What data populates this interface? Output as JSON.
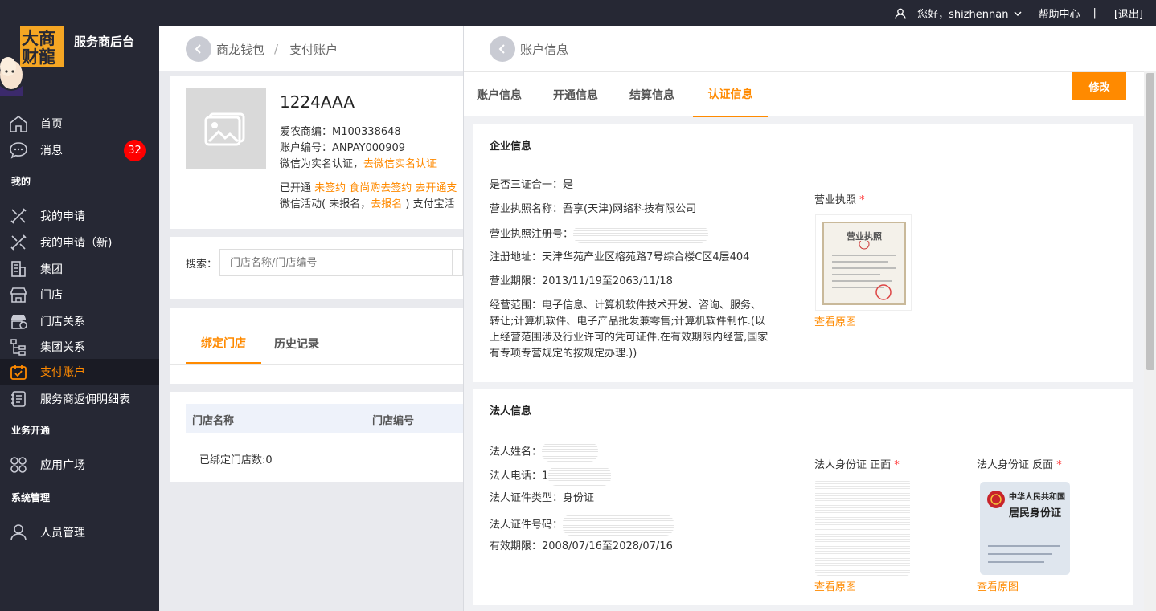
{
  "topbar": {
    "greeting": "您好，shizhennan",
    "help": "帮助中心",
    "separator": "|",
    "logout": "[退出]"
  },
  "sidebar": {
    "logo_text": "大商财龍",
    "brand": "服务商后台",
    "items": [
      {
        "label": "首页",
        "icon": "home-icon"
      },
      {
        "label": "消息",
        "icon": "message-icon",
        "badge": "32"
      },
      {
        "section": "我的"
      },
      {
        "label": "我的申请",
        "icon": "apply-icon"
      },
      {
        "label": "我的申请（新)",
        "icon": "apply-new-icon"
      },
      {
        "label": "集团",
        "icon": "building-icon"
      },
      {
        "label": "门店",
        "icon": "store-icon"
      },
      {
        "label": "门店关系",
        "icon": "store-relation-icon"
      },
      {
        "label": "集团关系",
        "icon": "group-relation-icon"
      },
      {
        "label": "支付账户",
        "icon": "payment-account-icon",
        "active": true
      },
      {
        "label": "服务商返佣明细表",
        "icon": "commission-icon"
      },
      {
        "section": "业务开通"
      },
      {
        "label": "应用广场",
        "icon": "apps-icon"
      },
      {
        "section": "系统管理"
      },
      {
        "label": "人员管理",
        "icon": "user-icon"
      }
    ]
  },
  "main": {
    "breadcrumb": {
      "first": "商龙钱包",
      "sep": "/",
      "second": "支付账户"
    },
    "account": {
      "name": "1224AAA",
      "merchant_id": "爱农商编：M100338648",
      "account_no": "账户编号：ANPAY000909",
      "wechat_verify_prefix": "微信为实名认证，",
      "wechat_verify_link": "去微信实名认证",
      "opened_prefix": "已开通",
      "opened_status": "未签约 食尚购去签约 去开通支",
      "wechat_activity_prefix": "微信活动( 未报名，",
      "wechat_activity_link": "去报名",
      "wechat_activity_suffix": ") 支付宝活"
    },
    "search": {
      "label": "搜索：",
      "placeholder": "门店名称/门店编号"
    },
    "tabs": [
      "绑定门店",
      "历史记录"
    ],
    "table": {
      "headers": [
        "门店名称",
        "门店编号"
      ],
      "summary": "已绑定门店数:0"
    }
  },
  "panel": {
    "title": "账户信息",
    "tabs": [
      "账户信息",
      "开通信息",
      "结算信息",
      "认证信息"
    ],
    "active_tab": "认证信息",
    "edit_button": "修改",
    "enterprise": {
      "title": "企业信息",
      "three_in_one": "是否三证合一：是",
      "license_name": "营业执照名称：吾享(天津)网络科技有限公司",
      "license_no_label": "营业执照注册号：",
      "address": "注册地址：天津华苑产业区榕苑路7号综合楼C区4层404",
      "period": "营业期限：2013/11/19至2063/11/18",
      "scope_1": "经营范围：电子信息、计算机软件技术开发、咨询、服务、",
      "scope_2": "转让;计算机软件、电子产品批发兼零售;计算机软件制作.(以",
      "scope_3": "上经营范围涉及行业许可的凭可证件,在有效期限内经营,国家",
      "scope_4": "有专项专营规定的按规定办理.))",
      "license_image_label": "营业执照",
      "required_mark": "*",
      "license_image_title": "营业执照",
      "view_original": "查看原图"
    },
    "legal": {
      "title": "法人信息",
      "name_label": "法人姓名：",
      "phone_label": "法人电话：",
      "phone_prefix": "1",
      "cert_type": "法人证件类型：身份证",
      "cert_no_label": "法人证件号码：",
      "valid_period": "有效期限：2008/07/16至2028/07/16",
      "id_front_label": "法人身份证 正面",
      "id_back_label": "法人身份证 反面",
      "id_back_title_1": "中华人民共和国",
      "id_back_title_2": "居民身份证",
      "view_original": "查看原图"
    }
  }
}
